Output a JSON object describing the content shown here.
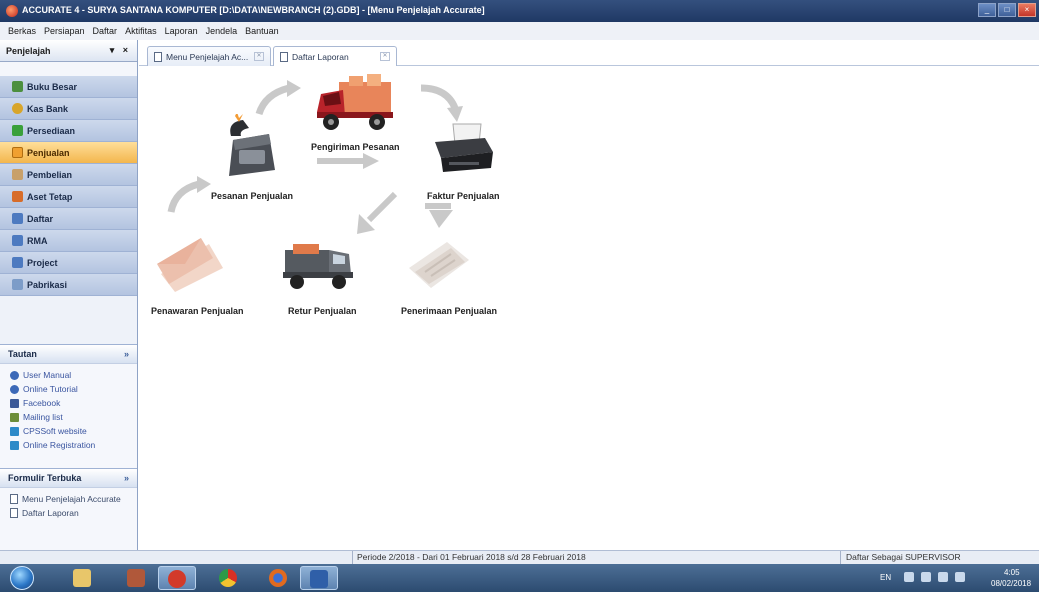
{
  "window": {
    "title": "ACCURATE 4 - SURYA SANTANA KOMPUTER  [D:\\DATA\\NEWBRANCH (2).GDB] - [Menu Penjelajah Accurate]",
    "controls": [
      "_",
      "□",
      "×"
    ]
  },
  "menubar": {
    "items": [
      "Berkas",
      "Persiapan",
      "Daftar",
      "Aktifitas",
      "Laporan",
      "Jendela",
      "Bantuan"
    ]
  },
  "navigator": {
    "title": "Penjelajah",
    "controls": "▾ ×",
    "items": [
      {
        "label": "Buku Besar",
        "icon": "ledger-icon",
        "color": "#4c8f3f"
      },
      {
        "label": "Kas Bank",
        "icon": "coins-icon",
        "color": "#d8a52a"
      },
      {
        "label": "Persediaan",
        "icon": "inventory-arrows-icon",
        "color": "#3aa03a"
      },
      {
        "label": "Penjualan",
        "icon": "sales-icon",
        "color": "#f0a030",
        "active": true
      },
      {
        "label": "Pembelian",
        "icon": "purchase-icon",
        "color": "#c8a06a"
      },
      {
        "label": "Aset Tetap",
        "icon": "house-icon",
        "color": "#d76c2a"
      },
      {
        "label": "Daftar",
        "icon": "list-icon",
        "color": "#4d7ac0"
      },
      {
        "label": "RMA",
        "icon": "rma-icon",
        "color": "#4d7ac0"
      },
      {
        "label": "Project",
        "icon": "project-icon",
        "color": "#4d7ac0"
      },
      {
        "label": "Pabrikasi",
        "icon": "factory-icon",
        "color": "#7c9cc8"
      }
    ]
  },
  "links": {
    "title": "Tautan",
    "chevron": "»",
    "items": [
      {
        "label": "User Manual",
        "icon": "help-icon"
      },
      {
        "label": "Online Tutorial",
        "icon": "help-icon"
      },
      {
        "label": "Facebook",
        "icon": "facebook-icon"
      },
      {
        "label": "Mailing list",
        "icon": "people-icon"
      },
      {
        "label": "CPSSoft website",
        "icon": "web-icon"
      },
      {
        "label": "Online Registration",
        "icon": "web-icon"
      }
    ]
  },
  "open_forms": {
    "title": "Formulir Terbuka",
    "chevron": "»",
    "items": [
      "Menu Penjelajah Accurate",
      "Daftar Laporan"
    ]
  },
  "tabs": [
    {
      "label": "Menu Penjelajah Ac...",
      "active": false
    },
    {
      "label": "Daftar Laporan",
      "active": true
    }
  ],
  "flow": {
    "pesanan": "Pesanan Penjualan",
    "pengiriman": "Pengiriman Pesanan",
    "faktur": "Faktur Penjualan",
    "penawaran": "Penawaran Penjualan",
    "retur": "Retur Penjualan",
    "penerimaan": "Penerimaan Penjualan"
  },
  "status": {
    "period": "Periode 2/2018 - Dari 01 Februari 2018 s/d 28 Februari 2018",
    "user": "Daftar Sebagai SUPERVISOR"
  },
  "taskbar": {
    "apps": [
      {
        "name": "explorer-icon",
        "color": "#e8c66a"
      },
      {
        "name": "winrar-icon",
        "color": "#b0583a"
      },
      {
        "name": "accurate-icon",
        "color": "#d23a2a",
        "active": true
      },
      {
        "name": "chrome-icon",
        "color": "#e0a020"
      },
      {
        "name": "firefox-icon",
        "color": "#e06a20"
      },
      {
        "name": "word-icon",
        "color": "#2f5fa8",
        "active": true
      }
    ],
    "language": "EN",
    "time": "4:05",
    "date": "08/02/2018"
  }
}
